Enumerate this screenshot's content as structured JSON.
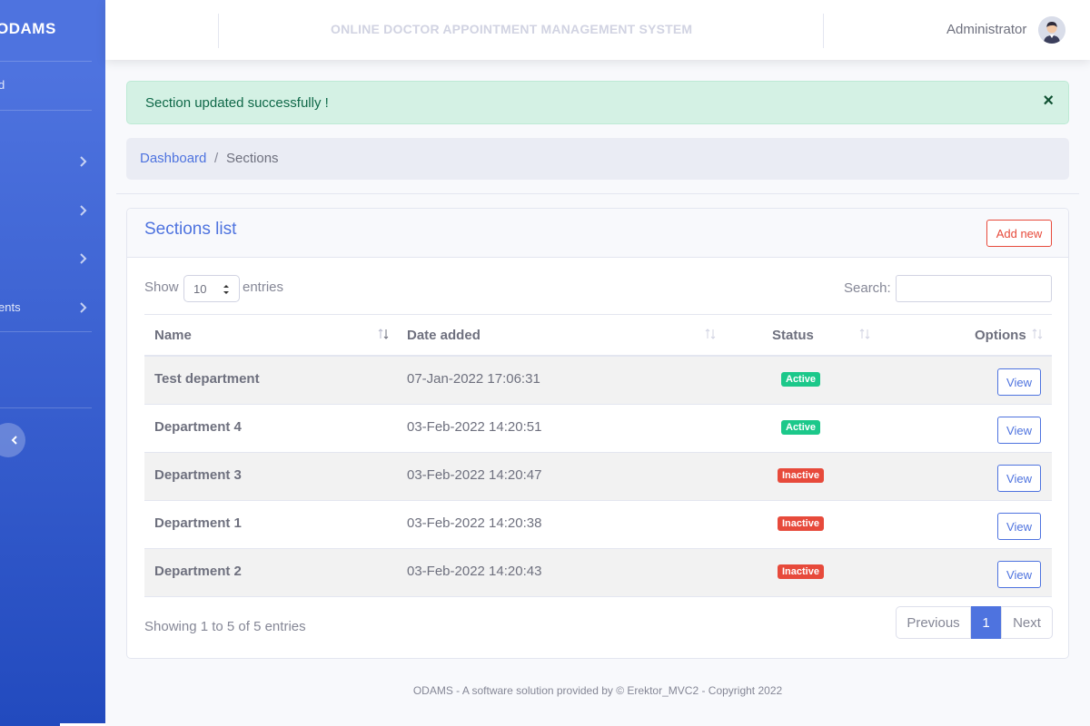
{
  "sidebar": {
    "brand": "ODAMS",
    "items": [
      {
        "label": "d"
      },
      {
        "label": ""
      },
      {
        "label": ""
      },
      {
        "label": ""
      },
      {
        "label": "ents"
      }
    ]
  },
  "topbar": {
    "system_title": "ONLINE DOCTOR APPOINTMENT MANAGEMENT SYSTEM",
    "user_name": "Administrator"
  },
  "alert": {
    "message": "Section updated successfully !",
    "close": "×"
  },
  "breadcrumb": {
    "home": "Dashboard",
    "separator": "/",
    "current": "Sections"
  },
  "card": {
    "title": "Sections list",
    "add_button": "Add new"
  },
  "controls": {
    "show_label": "Show",
    "entries_value": "10",
    "entries_label": "entries",
    "search_label": "Search:",
    "search_value": ""
  },
  "table": {
    "headers": [
      "Name",
      "Date added",
      "Status",
      "Options"
    ],
    "rows": [
      {
        "name": "Test department",
        "date": "07-Jan-2022 17:06:31",
        "status": "Active",
        "action": "View"
      },
      {
        "name": "Department 4",
        "date": "03-Feb-2022 14:20:51",
        "status": "Active",
        "action": "View"
      },
      {
        "name": "Department 3",
        "date": "03-Feb-2022 14:20:47",
        "status": "Inactive",
        "action": "View"
      },
      {
        "name": "Department 1",
        "date": "03-Feb-2022 14:20:38",
        "status": "Inactive",
        "action": "View"
      },
      {
        "name": "Department 2",
        "date": "03-Feb-2022 14:20:43",
        "status": "Inactive",
        "action": "View"
      }
    ]
  },
  "pagination": {
    "info": "Showing 1 to 5 of 5 entries",
    "previous": "Previous",
    "current": "1",
    "next": "Next"
  },
  "footer": {
    "text": "ODAMS - A software solution provided by © Erektor_MVC2 - Copyright 2022"
  },
  "colors": {
    "primary": "#4e73df",
    "success": "#1cc88a",
    "danger": "#e74a3b",
    "alert_bg": "#d4f1e4"
  },
  "icons": {
    "chevron": "chevron-right-icon",
    "collapse": "chevron-left-icon",
    "close": "close-icon",
    "sort": "sort-icon",
    "select_arrow": "select-arrows-icon",
    "avatar": "user-avatar-icon"
  }
}
